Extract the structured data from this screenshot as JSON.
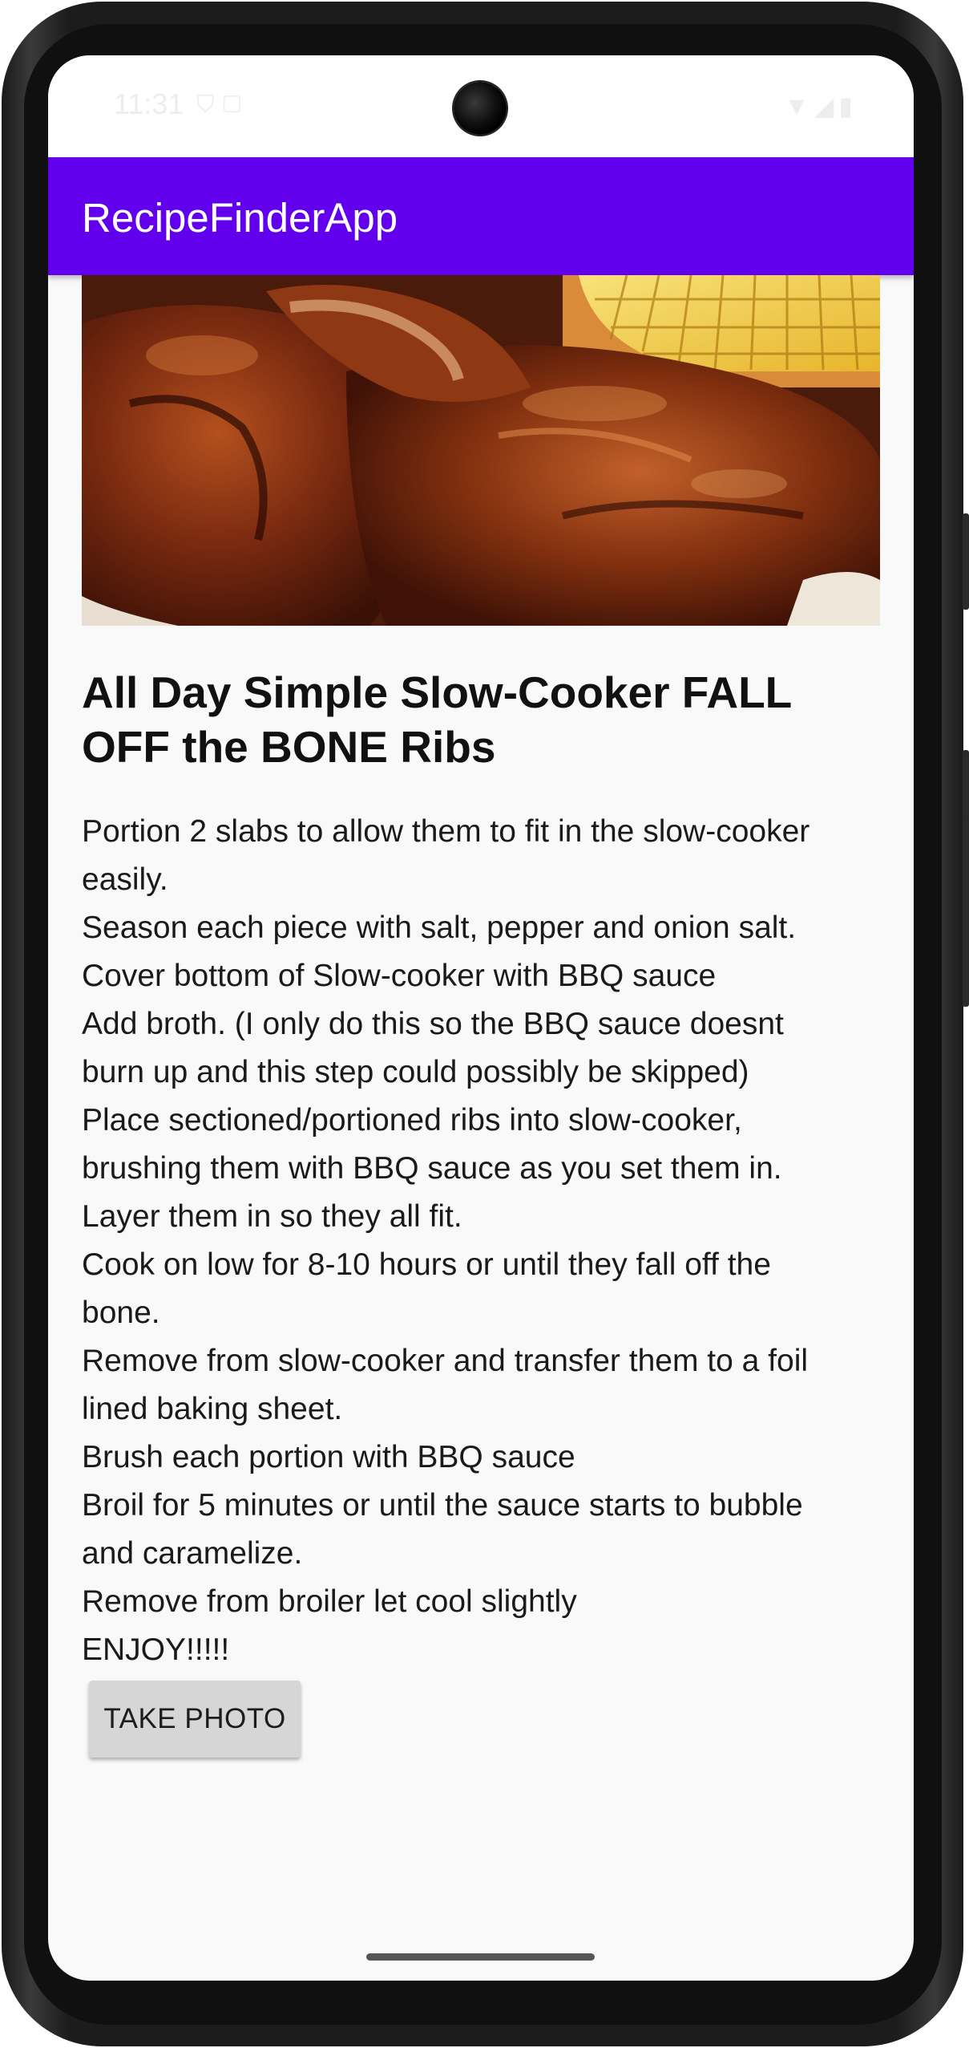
{
  "status_bar": {
    "time": "11:31",
    "left_icons": [
      "shield-icon",
      "sd-card-icon"
    ],
    "right_icons": [
      "wifi-icon",
      "signal-icon",
      "battery-icon"
    ]
  },
  "app_bar": {
    "title": "RecipeFinderApp",
    "color": "#6200ee"
  },
  "recipe": {
    "image_alt": "BBQ ribs with corn on the cob",
    "title": "All Day Simple Slow-Cooker FALL OFF the BONE Ribs",
    "instruction_lines": [
      "Portion 2 slabs to allow them to fit in the slow-cooker",
      "easily.",
      "Season each piece with salt, pepper and onion salt.",
      "Cover bottom of Slow-cooker with BBQ sauce",
      "Add broth. (I only do this so the BBQ sauce doesnt",
      "burn up and this step could possibly be skipped)",
      "Place sectioned/portioned ribs into slow-cooker,",
      "brushing them with BBQ sauce as you set them in.",
      "Layer them in so they all fit.",
      "Cook on low for 8-10 hours or until they fall off the",
      "bone.",
      "Remove from slow-cooker and transfer them to a foil",
      "lined baking sheet.",
      "Brush each portion with BBQ sauce",
      "Broil for 5 minutes or until the sauce starts to bubble",
      "and caramelize.",
      "Remove from broiler let cool slightly",
      "ENJOY!!!!!"
    ]
  },
  "actions": {
    "take_photo_label": "TAKE PHOTO"
  }
}
